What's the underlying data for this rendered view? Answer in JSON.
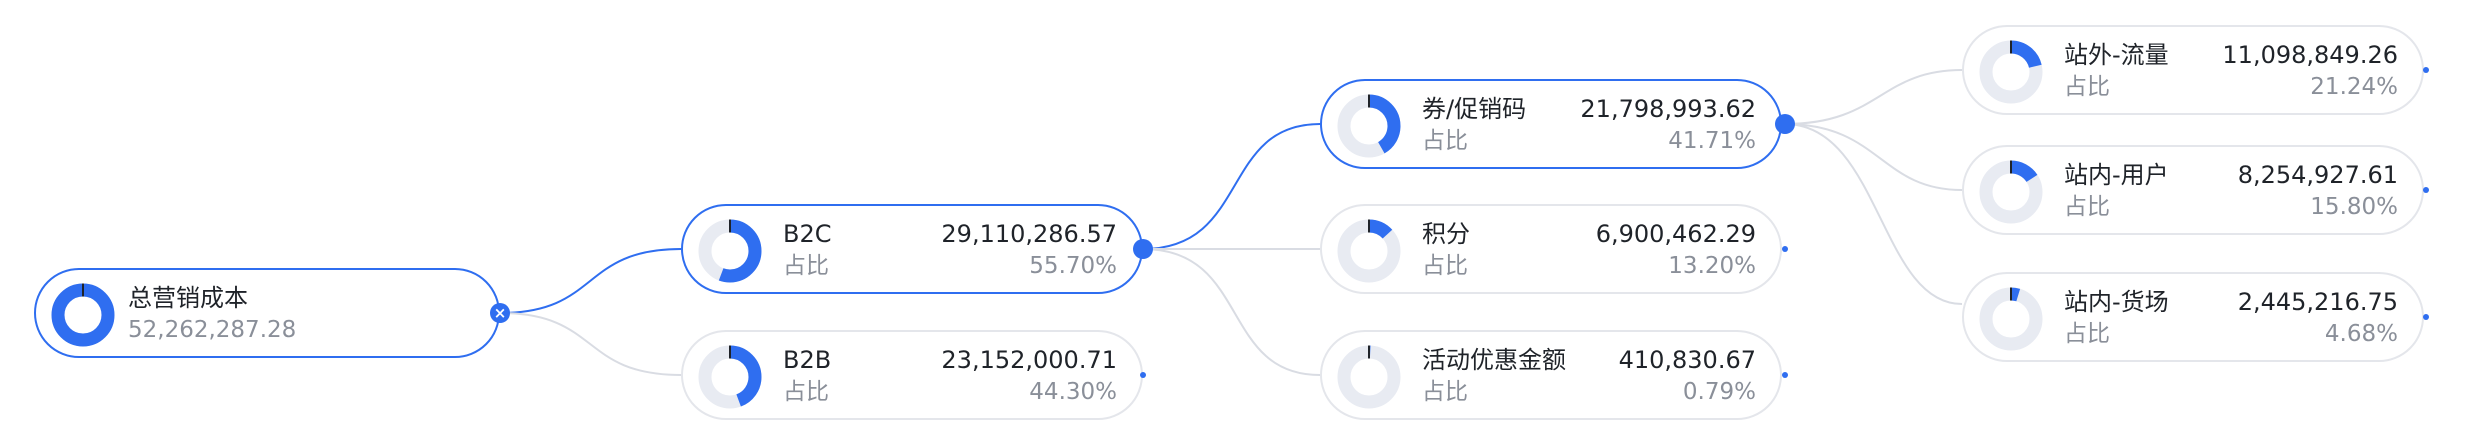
{
  "colors": {
    "accent": "#2f6ef0",
    "track": "#e8ebf2",
    "border": "#e4e6eb",
    "link": "#d9dce3"
  },
  "icons": {
    "collapse": "close-icon"
  },
  "root": {
    "label": "总营销成本",
    "value": "52,262,287.28"
  },
  "level1": [
    {
      "label": "B2C",
      "value": "29,110,286.57",
      "sub": "占比",
      "pct": "55.70%",
      "share": 0.557
    },
    {
      "label": "B2B",
      "value": "23,152,000.71",
      "sub": "占比",
      "pct": "44.30%",
      "share": 0.443
    }
  ],
  "level2": [
    {
      "label": "券/促销码",
      "value": "21,798,993.62",
      "sub": "占比",
      "pct": "41.71%",
      "share": 0.4171
    },
    {
      "label": "积分",
      "value": "6,900,462.29",
      "sub": "占比",
      "pct": "13.20%",
      "share": 0.132
    },
    {
      "label": "活动优惠金额",
      "value": "410,830.67",
      "sub": "占比",
      "pct": "0.79%",
      "share": 0.0079
    }
  ],
  "level3": [
    {
      "label": "站外-流量",
      "value": "11,098,849.26",
      "sub": "占比",
      "pct": "21.24%",
      "share": 0.2124
    },
    {
      "label": "站内-用户",
      "value": "8,254,927.61",
      "sub": "占比",
      "pct": "15.80%",
      "share": 0.158
    },
    {
      "label": "站内-货场",
      "value": "2,445,216.75",
      "sub": "占比",
      "pct": "4.68%",
      "share": 0.0468
    }
  ]
}
